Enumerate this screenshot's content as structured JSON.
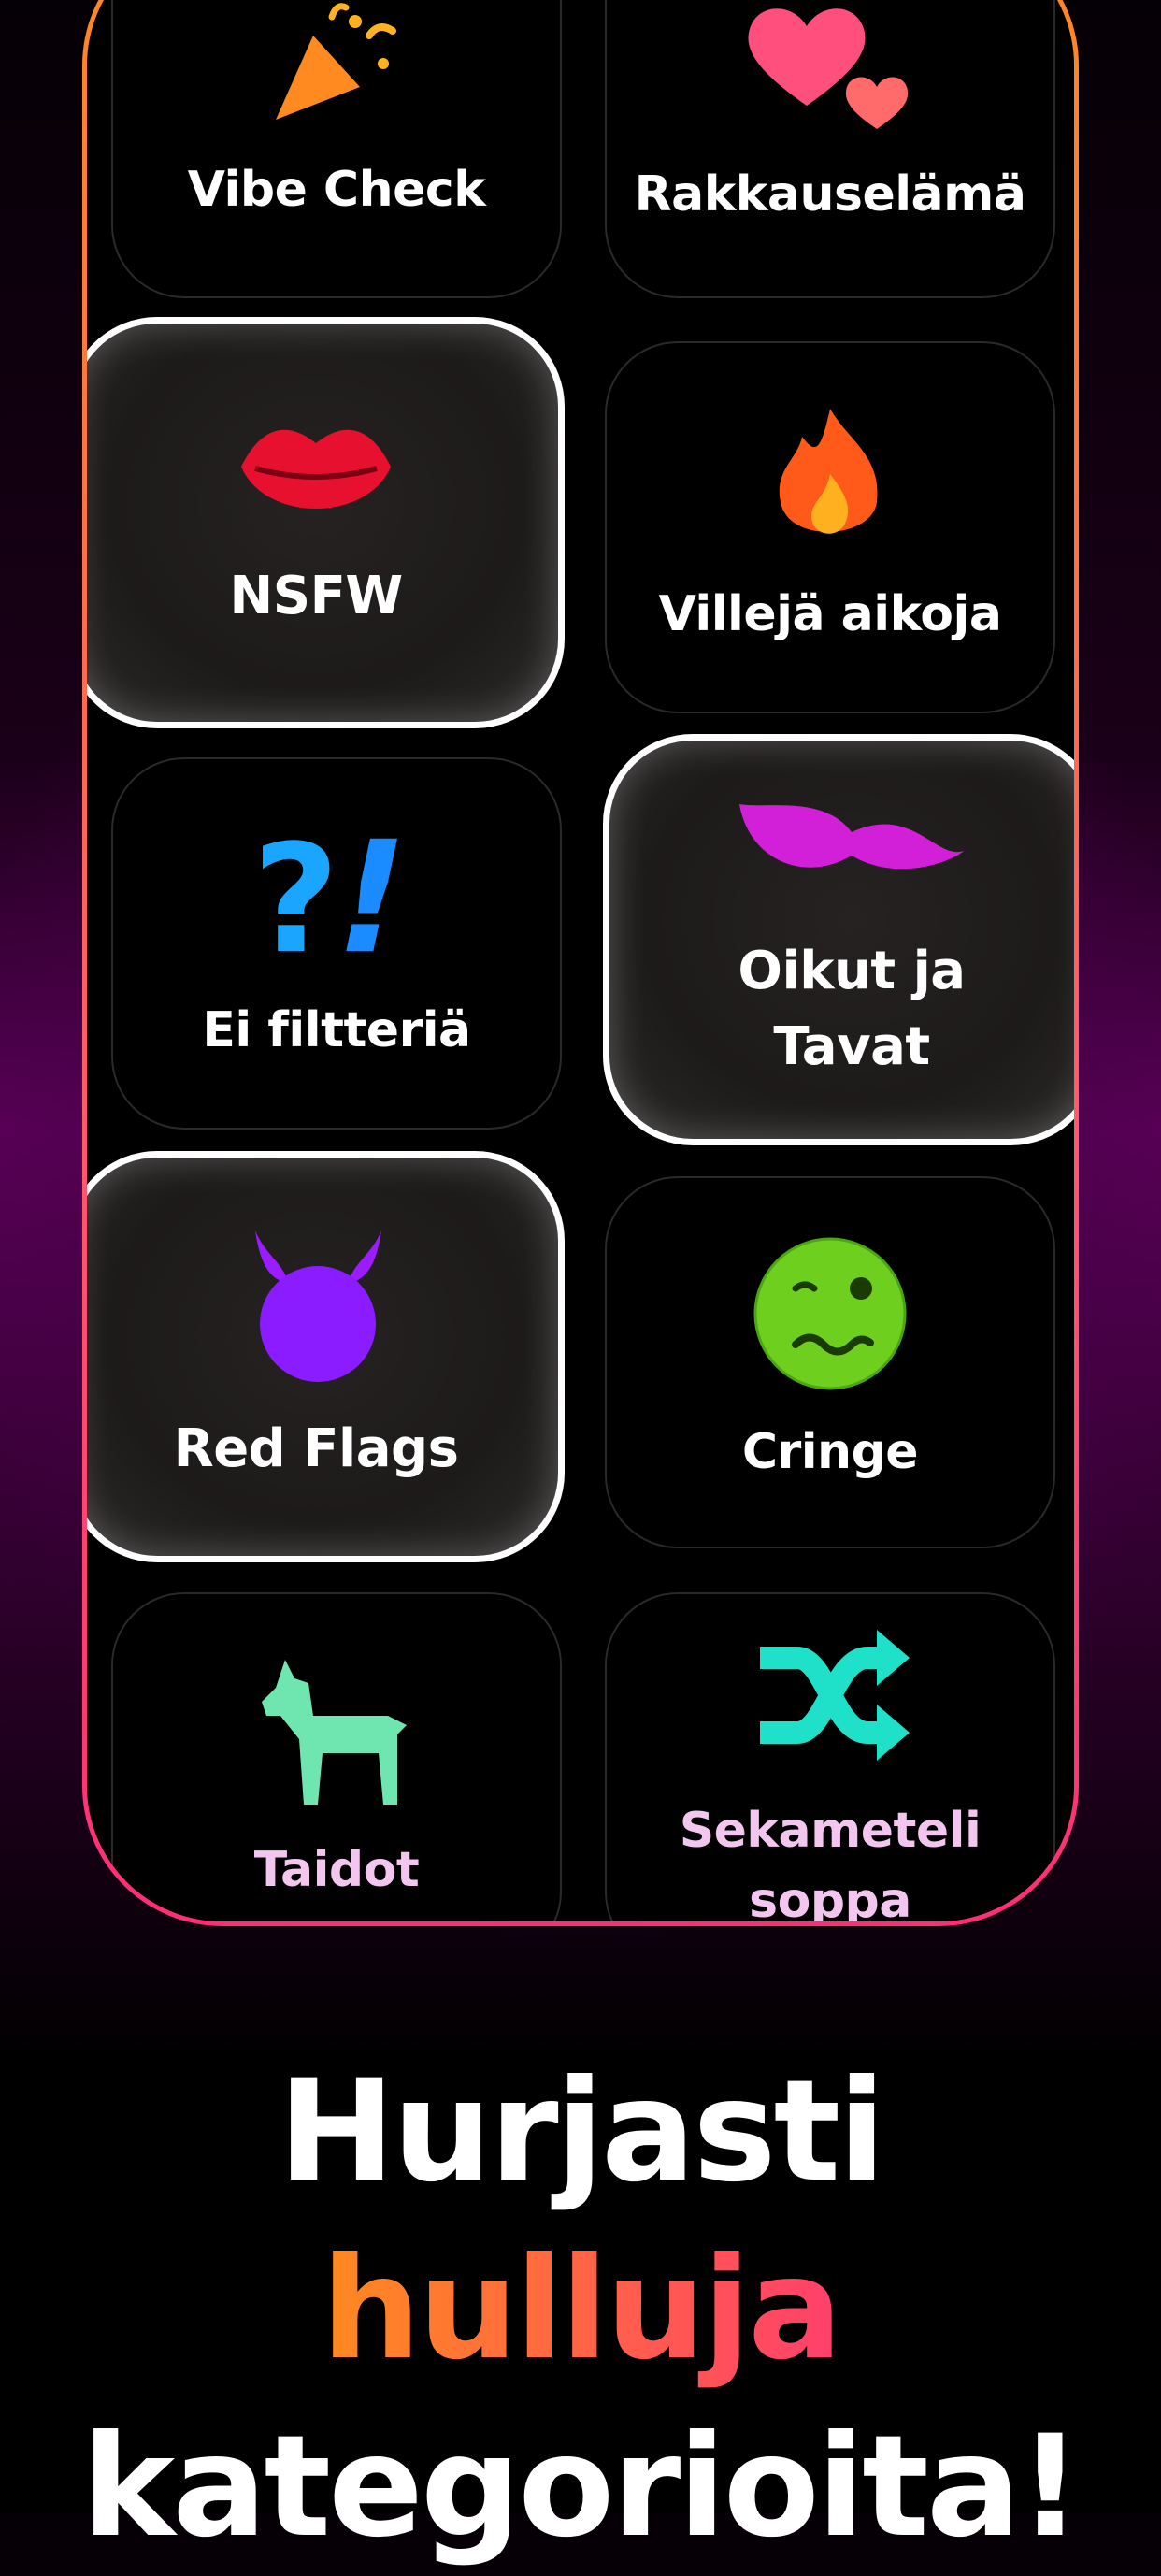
{
  "categories": [
    {
      "label": "Vibe Check",
      "icon": "party-popper-icon",
      "selected": false
    },
    {
      "label": "Rakkauselämä",
      "icon": "hearts-icon",
      "selected": false
    },
    {
      "label": "NSFW",
      "icon": "lips-icon",
      "selected": true
    },
    {
      "label": "Villejä aikoja",
      "icon": "fire-icon",
      "selected": false
    },
    {
      "label": "Ei filtteriä",
      "icon": "question-exclamation-icon",
      "selected": false
    },
    {
      "label": "Oikut ja Tavat",
      "label_line1": "Oikut ja",
      "label_line2": "Tavat",
      "icon": "mustache-icon",
      "selected": true
    },
    {
      "label": "Red Flags",
      "icon": "devil-icon",
      "selected": true
    },
    {
      "label": "Cringe",
      "icon": "woozy-face-icon",
      "selected": false
    },
    {
      "label": "Taidot",
      "icon": "goat-icon",
      "selected": false
    },
    {
      "label": "Sekameteli soppa",
      "label_line1": "Sekameteli",
      "label_line2": "soppa",
      "icon": "shuffle-icon",
      "selected": false
    }
  ],
  "headline": {
    "part1": "Hurjasti ",
    "highlight": "hulluja",
    "line2": "kategorioita!"
  },
  "colors": {
    "accent_orange": "#ff8a1f",
    "accent_pink": "#ff3f6c",
    "bottom_label_pink": "#f3c6f0"
  }
}
